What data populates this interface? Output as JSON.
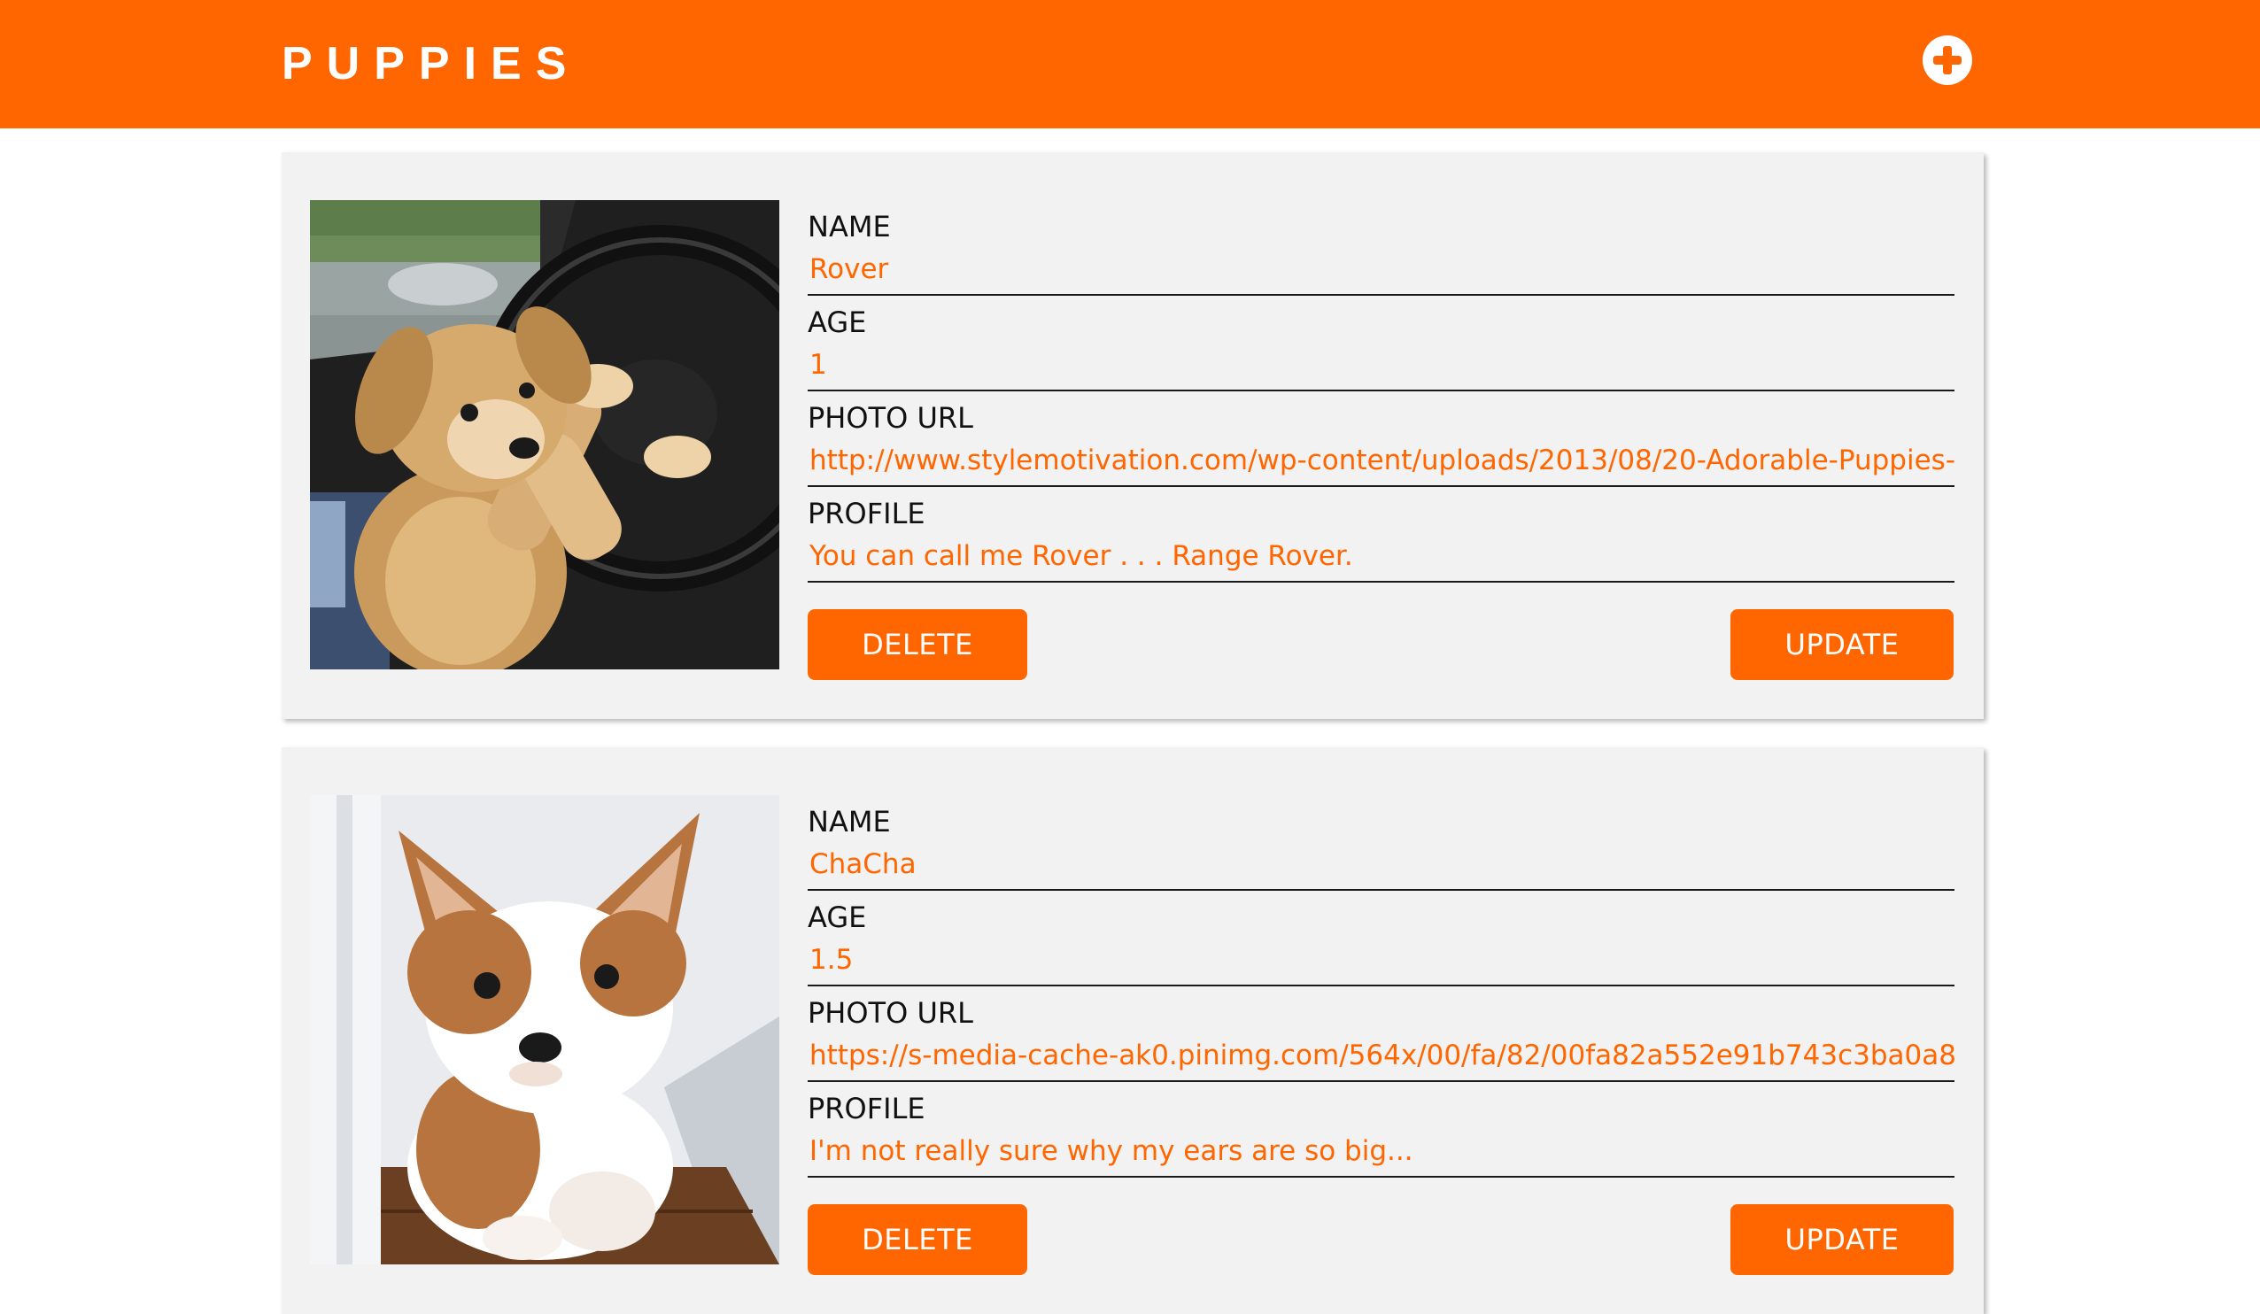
{
  "header": {
    "brand": "PUPPIES",
    "add_icon": "plus-circle-icon",
    "colors": {
      "bar": "#ff6600",
      "text": "#ffffff"
    }
  },
  "labels": {
    "name": "NAME",
    "age": "AGE",
    "photo_url": "PHOTO URL",
    "profile": "PROFILE",
    "delete": "DELETE",
    "update": "UPDATE"
  },
  "colors": {
    "accent": "#ff6600",
    "card_bg": "#f2f2f2",
    "label_text": "#111111"
  },
  "puppies": [
    {
      "name": "Rover",
      "age": "1",
      "photo_url": "http://www.stylemotivation.com/wp-content/uploads/2013/08/20-Adorable-Puppies-4",
      "profile": "You can call me Rover . . . Range Rover.",
      "photo": "puppy-at-steering-wheel-photo"
    },
    {
      "name": "ChaCha",
      "age": "1.5",
      "photo_url": "https://s-media-cache-ak0.pinimg.com/564x/00/fa/82/00fa82a552e91b743c3ba0a8e",
      "profile": "I'm not really sure why my ears are so big...",
      "photo": "corgi-puppy-by-window-photo"
    }
  ]
}
